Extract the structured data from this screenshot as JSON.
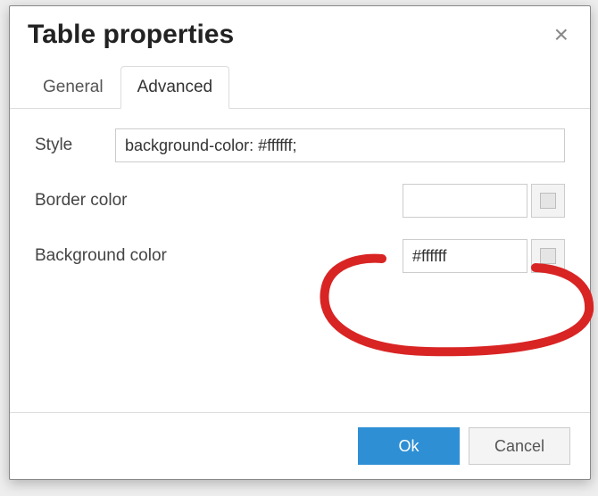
{
  "dialog": {
    "title": "Table properties",
    "close_glyph": "×"
  },
  "tabs": {
    "general": "General",
    "advanced": "Advanced",
    "active": "advanced"
  },
  "fields": {
    "style": {
      "label": "Style",
      "value": "background-color: #ffffff;"
    },
    "border_color": {
      "label": "Border color",
      "value": ""
    },
    "background_color": {
      "label": "Background color",
      "value": "#ffffff"
    }
  },
  "buttons": {
    "ok": "Ok",
    "cancel": "Cancel"
  }
}
